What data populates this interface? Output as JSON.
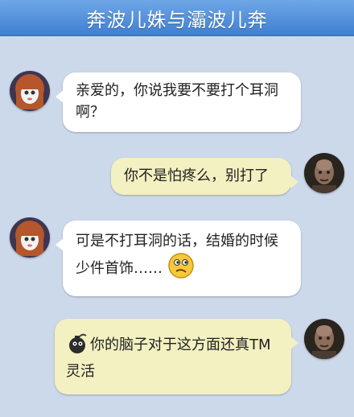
{
  "header": {
    "title": "奔波儿姝与灞波儿奔"
  },
  "colors": {
    "header": "#4a8ad9",
    "background": "#ccd9ea",
    "left_bubble": "#ffffff",
    "right_bubble": "#f3f0c1"
  },
  "messages": [
    {
      "side": "left",
      "avatar": "girl-avatar",
      "text": "亲爱的，你说我要不要打个耳洞啊？"
    },
    {
      "side": "right",
      "avatar": "monk-avatar",
      "text": "你不是怕疼么，别打了"
    },
    {
      "side": "left",
      "avatar": "girl-avatar",
      "text": "可是不打耳洞的话，结婚的时候少件首饰……",
      "emoji": "thinking-face-icon"
    },
    {
      "side": "right",
      "avatar": "monk-avatar",
      "text": "你的脑子对于这方面还真TM灵活",
      "emoji": "bomb-icon"
    }
  ]
}
